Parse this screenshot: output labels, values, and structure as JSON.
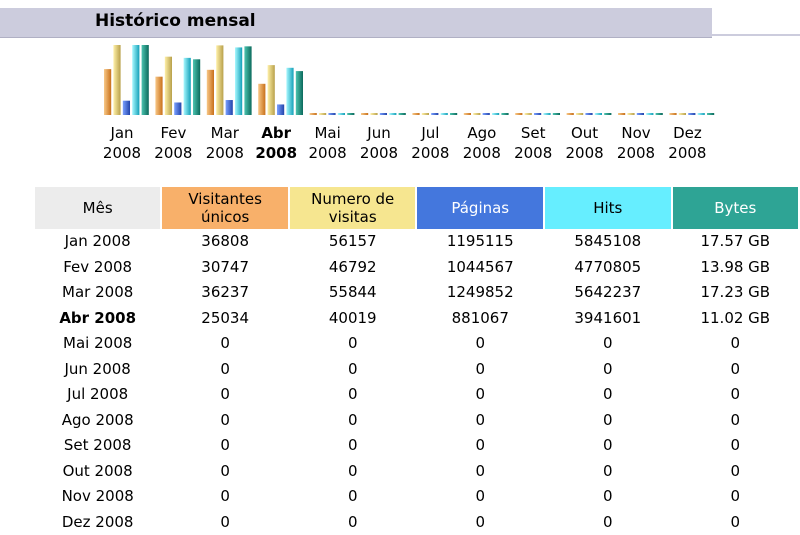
{
  "title": "Histórico mensal",
  "colors": {
    "visitors": "#f8b06a",
    "visits": "#f6e690",
    "pages": "#4477dd",
    "hits": "#66eeff",
    "bytes": "#2ea495",
    "month_header": "#ececec",
    "title_bar": "#ccccdd"
  },
  "chart_data": {
    "type": "bar",
    "categories": [
      {
        "month": "Jan",
        "year": "2008"
      },
      {
        "month": "Fev",
        "year": "2008"
      },
      {
        "month": "Mar",
        "year": "2008"
      },
      {
        "month": "Abr",
        "year": "2008",
        "current": true
      },
      {
        "month": "Mai",
        "year": "2008"
      },
      {
        "month": "Jun",
        "year": "2008"
      },
      {
        "month": "Jul",
        "year": "2008"
      },
      {
        "month": "Ago",
        "year": "2008"
      },
      {
        "month": "Set",
        "year": "2008"
      },
      {
        "month": "Out",
        "year": "2008"
      },
      {
        "month": "Nov",
        "year": "2008"
      },
      {
        "month": "Dez",
        "year": "2008"
      }
    ],
    "series": [
      {
        "key": "visitors",
        "values": [
          36808,
          30747,
          36237,
          25034,
          0,
          0,
          0,
          0,
          0,
          0,
          0,
          0
        ]
      },
      {
        "key": "visits",
        "values": [
          56157,
          46792,
          55844,
          40019,
          0,
          0,
          0,
          0,
          0,
          0,
          0,
          0
        ]
      },
      {
        "key": "pages",
        "values": [
          1195115,
          1044567,
          1249852,
          881067,
          0,
          0,
          0,
          0,
          0,
          0,
          0,
          0
        ]
      },
      {
        "key": "hits",
        "values": [
          5845108,
          4770805,
          5642237,
          3941601,
          0,
          0,
          0,
          0,
          0,
          0,
          0,
          0
        ]
      },
      {
        "key": "bytes",
        "values": [
          17.57,
          13.98,
          17.23,
          11.02,
          0,
          0,
          0,
          0,
          0,
          0,
          0,
          0
        ]
      }
    ]
  },
  "table": {
    "headers": {
      "month": "Mês",
      "visitors": [
        "Visitantes",
        "únicos"
      ],
      "visits": [
        "Numero de",
        "visitas"
      ],
      "pages": "Páginas",
      "hits": "Hits",
      "bytes": "Bytes"
    },
    "rows": [
      {
        "month": "Jan 2008",
        "visitors": "36808",
        "visits": "56157",
        "pages": "1195115",
        "hits": "5845108",
        "bytes": "17.57 GB"
      },
      {
        "month": "Fev 2008",
        "visitors": "30747",
        "visits": "46792",
        "pages": "1044567",
        "hits": "4770805",
        "bytes": "13.98 GB"
      },
      {
        "month": "Mar 2008",
        "visitors": "36237",
        "visits": "55844",
        "pages": "1249852",
        "hits": "5642237",
        "bytes": "17.23 GB"
      },
      {
        "month": "Abr 2008",
        "visitors": "25034",
        "visits": "40019",
        "pages": "881067",
        "hits": "3941601",
        "bytes": "11.02 GB",
        "current": true
      },
      {
        "month": "Mai 2008",
        "visitors": "0",
        "visits": "0",
        "pages": "0",
        "hits": "0",
        "bytes": "0"
      },
      {
        "month": "Jun 2008",
        "visitors": "0",
        "visits": "0",
        "pages": "0",
        "hits": "0",
        "bytes": "0"
      },
      {
        "month": "Jul 2008",
        "visitors": "0",
        "visits": "0",
        "pages": "0",
        "hits": "0",
        "bytes": "0"
      },
      {
        "month": "Ago 2008",
        "visitors": "0",
        "visits": "0",
        "pages": "0",
        "hits": "0",
        "bytes": "0"
      },
      {
        "month": "Set 2008",
        "visitors": "0",
        "visits": "0",
        "pages": "0",
        "hits": "0",
        "bytes": "0"
      },
      {
        "month": "Out 2008",
        "visitors": "0",
        "visits": "0",
        "pages": "0",
        "hits": "0",
        "bytes": "0"
      },
      {
        "month": "Nov 2008",
        "visitors": "0",
        "visits": "0",
        "pages": "0",
        "hits": "0",
        "bytes": "0"
      },
      {
        "month": "Dez 2008",
        "visitors": "0",
        "visits": "0",
        "pages": "0",
        "hits": "0",
        "bytes": "0"
      }
    ]
  }
}
